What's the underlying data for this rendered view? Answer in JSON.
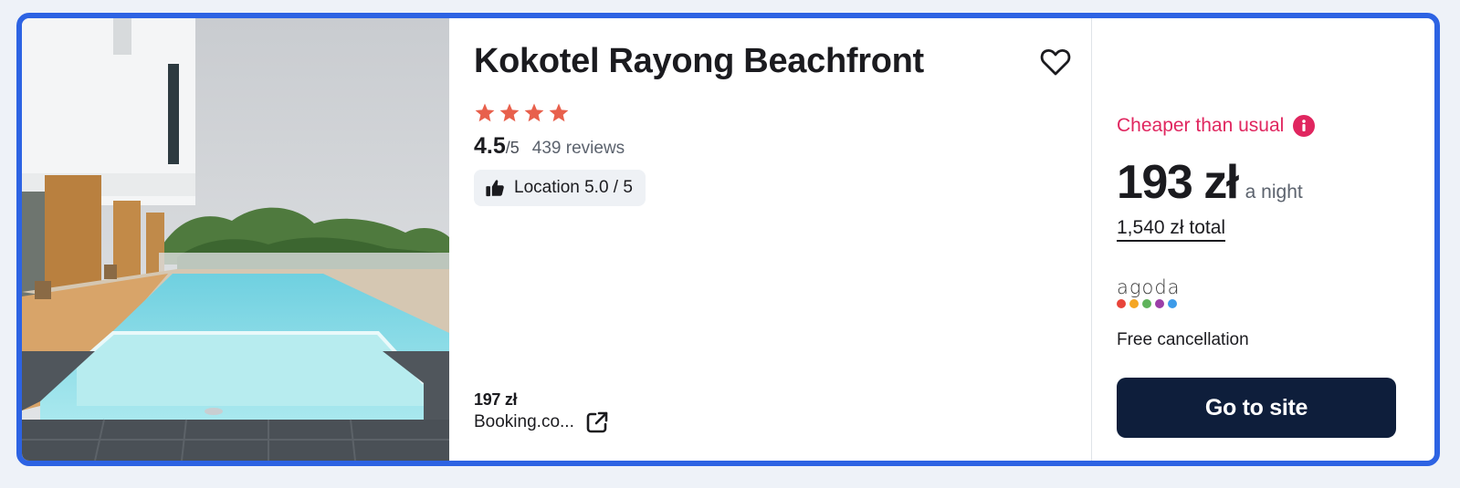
{
  "hotel": {
    "name": "Kokotel Rayong Beachfront",
    "star_count": 4,
    "rating_score": "4.5",
    "rating_max": "/5",
    "review_count": "439 reviews",
    "location_chip": "Location 5.0 / 5"
  },
  "alternative_offer": {
    "price": "197 zł",
    "provider": "Booking.co..."
  },
  "main_offer": {
    "deal_label": "Cheaper than usual",
    "price": "193 zł",
    "price_unit": "a night",
    "total": "1,540 zł total",
    "provider_logo_text": "agoda",
    "cancellation": "Free cancellation",
    "cta_label": "Go to site"
  },
  "icons": {
    "favorite": "heart-outline-icon",
    "star": "star-icon",
    "location": "thumbs-up-icon",
    "info": "info-icon",
    "external_link": "external-link-icon"
  },
  "colors": {
    "card_border": "#2d63e3",
    "star": "#e8604c",
    "deal_text": "#e0265f",
    "cta_background": "#0e1e3b",
    "agoda_dots": [
      "#e8443a",
      "#f5a623",
      "#5fb35b",
      "#9b3fa7",
      "#3d9be9"
    ]
  }
}
